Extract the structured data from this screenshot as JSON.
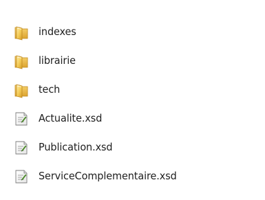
{
  "colors": {
    "background": "#ffffff",
    "text": "#1e1e1e",
    "folder_accent": "#f1c34e",
    "xsd_icon_accent": "#4f8c2d"
  },
  "files": [
    {
      "name": "indexes",
      "icon": "folder-icon",
      "type": "folder"
    },
    {
      "name": "librairie",
      "icon": "folder-icon",
      "type": "folder"
    },
    {
      "name": "tech",
      "icon": "folder-icon",
      "type": "folder"
    },
    {
      "name": "Actualite.xsd",
      "icon": "xsd-file-icon",
      "type": "file"
    },
    {
      "name": "Publication.xsd",
      "icon": "xsd-file-icon",
      "type": "file"
    },
    {
      "name": "ServiceComplementaire.xsd",
      "icon": "xsd-file-icon",
      "type": "file"
    }
  ]
}
